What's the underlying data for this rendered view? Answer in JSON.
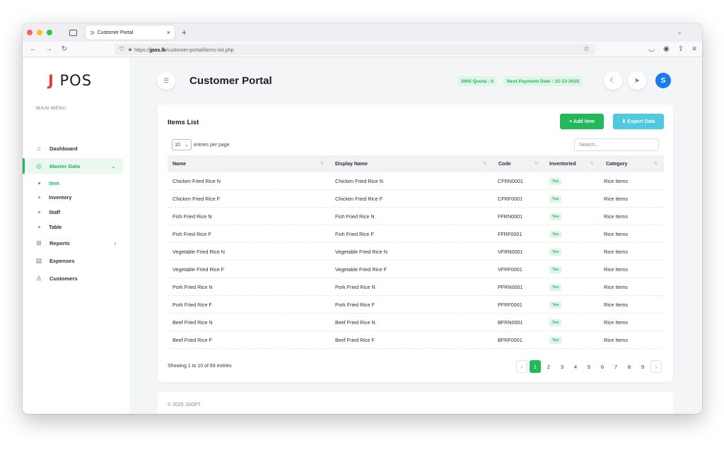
{
  "browser": {
    "tab_title": "Customer Portal",
    "tab_favicon": "⊃",
    "url_prefix": "https://",
    "url_host": "jpos.lk",
    "url_path": "/customer-portal/items-list.php"
  },
  "sidebar": {
    "logo_j": "J",
    "logo_text": "POS",
    "menu_title": "MAIN MENU",
    "items": [
      {
        "label": "Dashboard",
        "icon": "home-icon"
      },
      {
        "label": "Master Data",
        "icon": "eye-icon"
      },
      {
        "label": "Reports",
        "icon": "grid-icon"
      },
      {
        "label": "Expenses",
        "icon": "receipt-icon"
      },
      {
        "label": "Customers",
        "icon": "user-icon"
      }
    ],
    "sub_items": [
      "Item",
      "Inventory",
      "Staff",
      "Table"
    ]
  },
  "header": {
    "title": "Customer Portal",
    "sms_quota": "SMS Quota : 0",
    "next_payment": "Next Payment Date : 31-12-2025",
    "avatar_initial": "S"
  },
  "card": {
    "title": "Items List",
    "add_label": "+ Add Item",
    "export_label": "Export Data",
    "entries_value": "10",
    "entries_label": "entries per page",
    "search_placeholder": "Search...",
    "columns": [
      "Name",
      "Display Name",
      "Code",
      "Inventoried",
      "Category"
    ],
    "rows": [
      {
        "name": "Chicken Fried Rice N",
        "display": "Chicken Fried Rice N",
        "code": "CFRN0001",
        "inv": "Yes",
        "cat": "Rice Items"
      },
      {
        "name": "Chicken Fried Rice F",
        "display": "Chicken Fried Rice F",
        "code": "CFRF0001",
        "inv": "Yes",
        "cat": "Rice Items"
      },
      {
        "name": "Fish Fried Rice N",
        "display": "Fish Fried Rice N",
        "code": "FFRN0001",
        "inv": "Yes",
        "cat": "Rice Items"
      },
      {
        "name": "Fish Fried Rice F",
        "display": "Fish Fried Rice F",
        "code": "FFRF0001",
        "inv": "Yes",
        "cat": "Rice Items"
      },
      {
        "name": "Vegetable Fried Rice N",
        "display": "Vegetable Fried Rice N",
        "code": "VFRN0001",
        "inv": "Yes",
        "cat": "Rice Items"
      },
      {
        "name": "Vegetable Fried Rice F",
        "display": "Vegetable Fried Rice F",
        "code": "VFRF0001",
        "inv": "Yes",
        "cat": "Rice Items"
      },
      {
        "name": "Pork Fried Rice N",
        "display": "Pork Fried Rice N",
        "code": "PFRN0001",
        "inv": "Yes",
        "cat": "Rice Items"
      },
      {
        "name": "Pork Fried Rice F",
        "display": "Pork Fried Rice F",
        "code": "PFRF0001",
        "inv": "Yes",
        "cat": "Rice Items"
      },
      {
        "name": "Beef Fried Rice N",
        "display": "Beef Fried Rice N",
        "code": "BFRN0001",
        "inv": "Yes",
        "cat": "Rice Items"
      },
      {
        "name": "Beef Fried Rice F",
        "display": "Beef Fried Rice F",
        "code": "BFRF0001",
        "inv": "Yes",
        "cat": "Rice Items"
      }
    ],
    "showing": "Showing 1 to 10 of 89 entries",
    "pages": [
      "1",
      "2",
      "3",
      "4",
      "5",
      "6",
      "7",
      "8",
      "9"
    ],
    "prev": "‹",
    "next": "›"
  },
  "footer": {
    "text": "© 2025 JSOFT"
  },
  "colors": {
    "accent": "#23b85a",
    "export": "#4fc9e0",
    "avatar": "#1a7cf0",
    "brand": "#e53935"
  }
}
